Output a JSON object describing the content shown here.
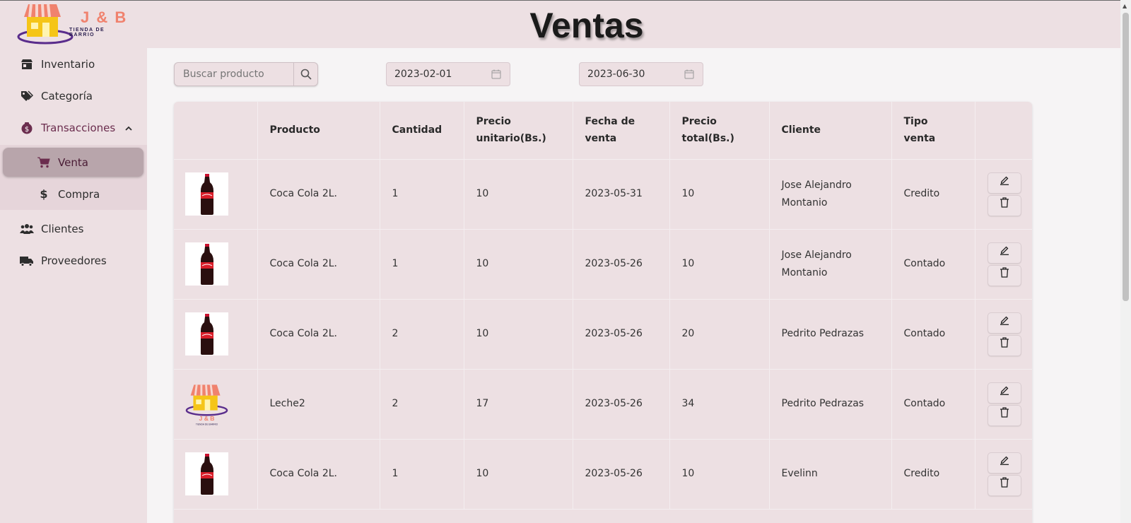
{
  "brand": {
    "name": "J & B",
    "tagline": "TIENDA DE BARRIO"
  },
  "header": {
    "title": "Ventas"
  },
  "sidebar": {
    "items": [
      {
        "label": "Inventario",
        "icon": "store-icon"
      },
      {
        "label": "Categoría",
        "icon": "tags-icon"
      },
      {
        "label": "Transacciones",
        "icon": "money-bag-icon",
        "expanded": true
      },
      {
        "label": "Clientes",
        "icon": "users-icon"
      },
      {
        "label": "Proveedores",
        "icon": "truck-icon"
      }
    ],
    "subitems": [
      {
        "label": "Venta",
        "icon": "cart-icon",
        "active": true
      },
      {
        "label": "Compra",
        "icon": "dollar-icon"
      }
    ]
  },
  "filters": {
    "search_placeholder": "Buscar producto",
    "date_from": "2023-02-01",
    "date_to": "2023-06-30"
  },
  "table": {
    "headers": {
      "producto": "Producto",
      "cantidad": "Cantidad",
      "precio_unitario": "Precio unitario(Bs.)",
      "fecha": "Fecha de venta",
      "precio_total": "Precio total(Bs.)",
      "cliente": "Cliente",
      "tipo": "Tipo venta"
    },
    "rows": [
      {
        "image": "coca-cola-bottle",
        "producto": "Coca Cola 2L.",
        "cantidad": "1",
        "precio_unitario": "10",
        "fecha": "2023-05-31",
        "precio_total": "10",
        "cliente": "Jose Alejandro Montanio",
        "tipo": "Credito"
      },
      {
        "image": "coca-cola-bottle",
        "producto": "Coca Cola 2L.",
        "cantidad": "1",
        "precio_unitario": "10",
        "fecha": "2023-05-26",
        "precio_total": "10",
        "cliente": "Jose Alejandro Montanio",
        "tipo": "Contado"
      },
      {
        "image": "coca-cola-bottle",
        "producto": "Coca Cola 2L.",
        "cantidad": "2",
        "precio_unitario": "10",
        "fecha": "2023-05-26",
        "precio_total": "20",
        "cliente": "Pedrito Pedrazas",
        "tipo": "Contado"
      },
      {
        "image": "store-logo",
        "producto": "Leche2",
        "cantidad": "2",
        "precio_unitario": "17",
        "fecha": "2023-05-26",
        "precio_total": "34",
        "cliente": "Pedrito Pedrazas",
        "tipo": "Contado"
      },
      {
        "image": "coca-cola-bottle",
        "producto": "Coca Cola 2L.",
        "cantidad": "1",
        "precio_unitario": "10",
        "fecha": "2023-05-26",
        "precio_total": "10",
        "cliente": "Evelinn",
        "tipo": "Credito"
      }
    ]
  },
  "colors": {
    "background": "#ede0e3",
    "active_nav": "#b8a5ab",
    "accent": "#6b2d4e",
    "logo": "#f0826e"
  }
}
